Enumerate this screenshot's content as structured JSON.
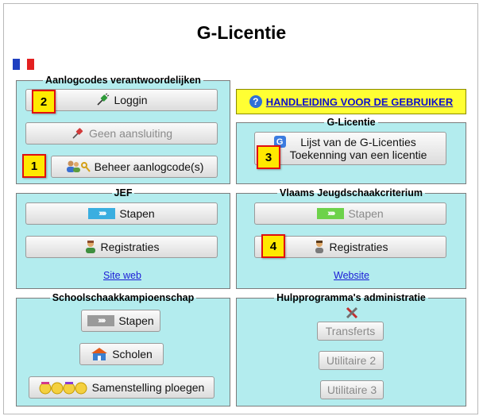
{
  "page": {
    "title": "G-Licentie"
  },
  "flag": {
    "colors": [
      "#1f3fc0",
      "#ffffff",
      "#e32020"
    ],
    "icon": "french-flag-icon"
  },
  "manual": {
    "label": "HANDLEIDING VOOR DE GEBRUIKER",
    "icon": "help-icon"
  },
  "aanlogcodes": {
    "legend": "Aanlogcodes verantwoordelijken",
    "login_label": "Loggin",
    "geen_label": "Geen aansluiting",
    "beheer_label": "Beheer aanlogcode(s)"
  },
  "glicentie": {
    "legend": "G-Licentie",
    "lijst_line1": "Lijst van de G-Licenties",
    "lijst_line2": "Toekenning van een licentie"
  },
  "jef": {
    "legend": "JEF",
    "stapen_label": "Stapen",
    "registraties_label": "Registraties",
    "link": "Site web"
  },
  "vjk": {
    "legend": "Vlaams Jeugdschaakcriterium",
    "stapen_label": "Stapen",
    "registraties_label": "Registraties",
    "link": "Website"
  },
  "school": {
    "legend": "Schoolschaakkampioenschap",
    "stapen_label": "Stapen",
    "scholen_label": "Scholen",
    "ploegen_label": "Samenstelling ploegen"
  },
  "hulp": {
    "legend": "Hulpprogramma's administratie",
    "transferts_label": "Transferts",
    "utilitaire2_label": "Utilitaire 2",
    "utilitaire3_label": "Utilitaire 3"
  },
  "badges": [
    "2",
    "1",
    "3",
    "4"
  ],
  "colors": {
    "panel_bg": "#b3ecee",
    "badge_bg": "#ffe900",
    "badge_border": "#e01010",
    "link": "#1a1ad6",
    "manual_bg": "#ffff33"
  }
}
